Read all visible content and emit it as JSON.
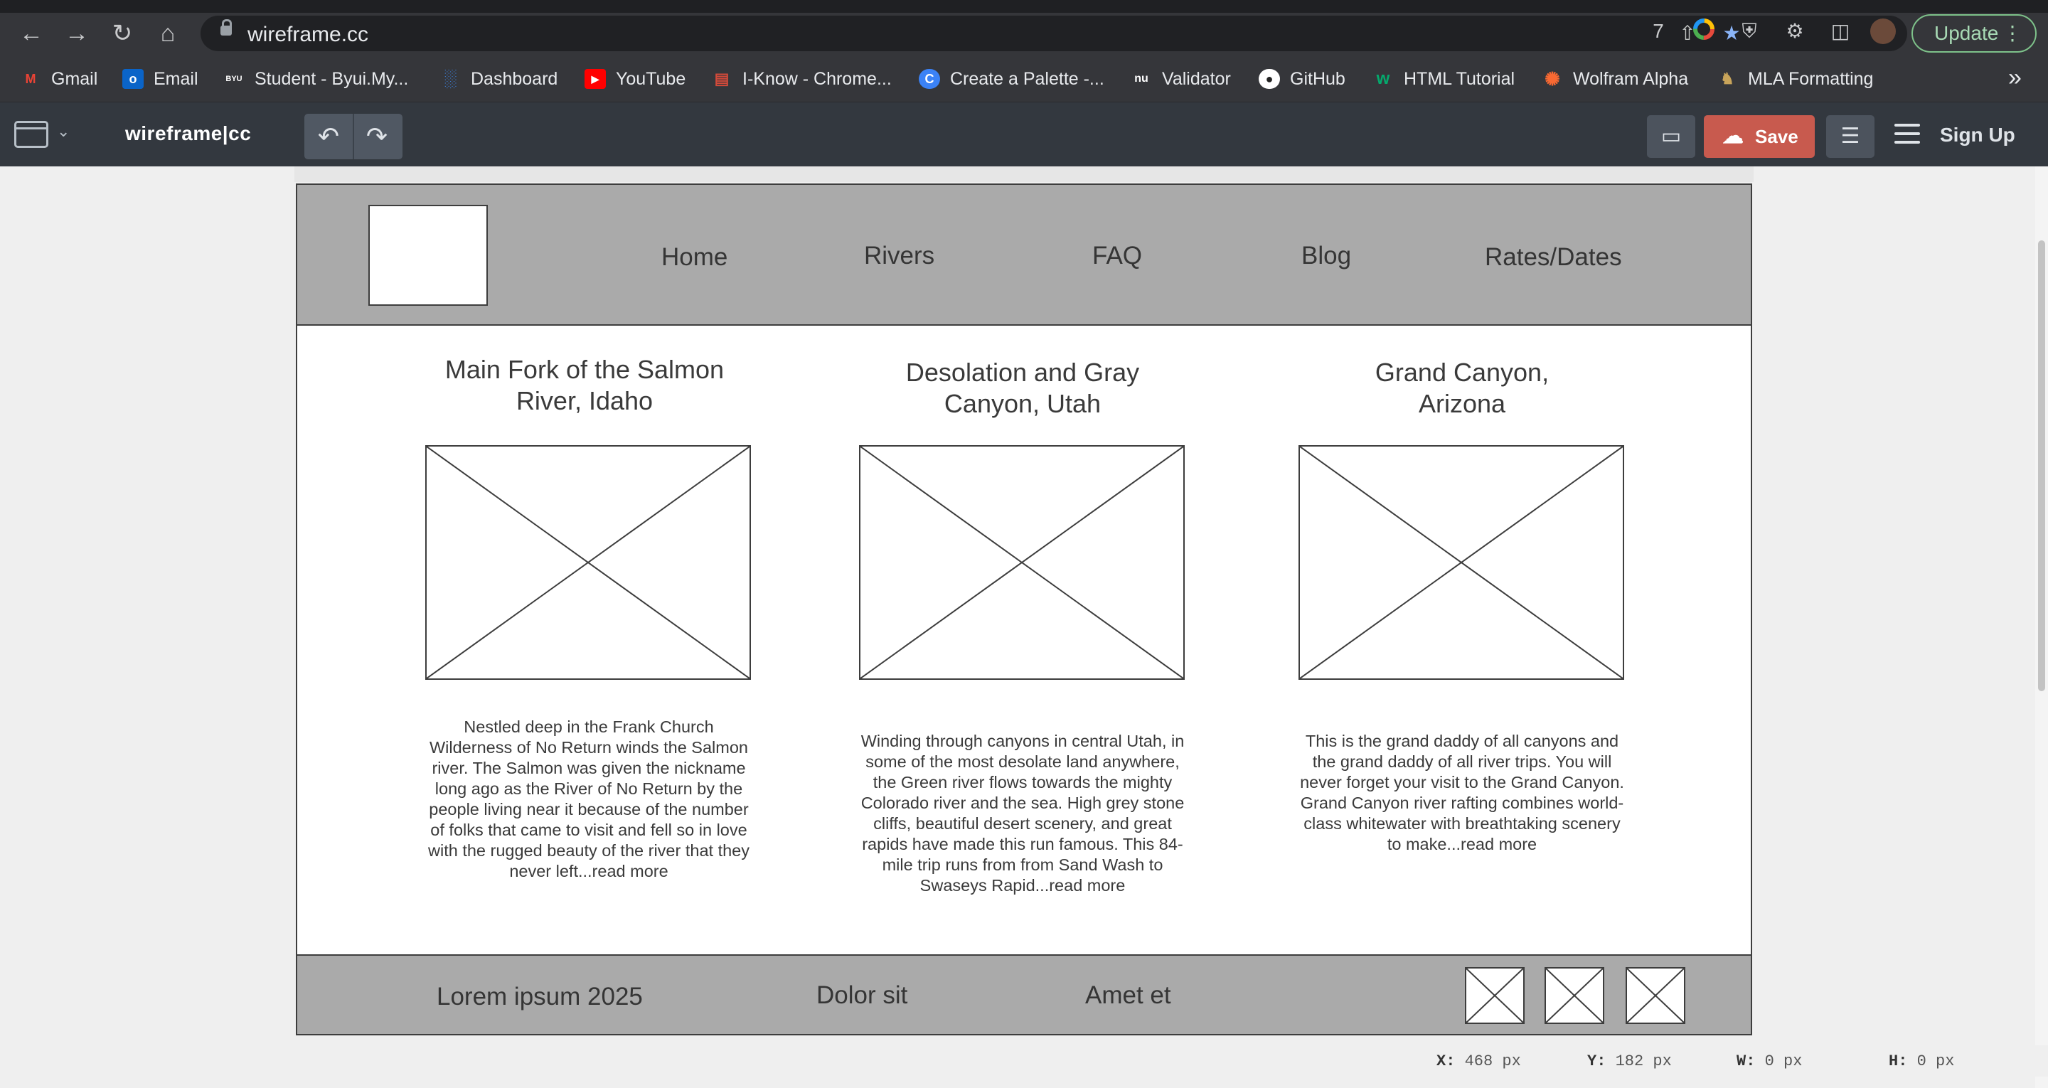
{
  "browser": {
    "url": "wireframe.cc",
    "update_label": "Update",
    "bookmarks": [
      {
        "label": "Gmail",
        "icon": "gmail-icon",
        "color": "#ea4335"
      },
      {
        "label": "Email",
        "icon": "outlook-icon",
        "color": "#0a64c8"
      },
      {
        "label": "Student - Byui.My...",
        "icon": "byui-icon",
        "color": "#555555"
      },
      {
        "label": "Dashboard",
        "icon": "dashboard-icon",
        "color": "#3d7bd0"
      },
      {
        "label": "YouTube",
        "icon": "youtube-icon",
        "color": "#ff0000"
      },
      {
        "label": "I-Know - Chrome...",
        "icon": "iknow-icon",
        "color": "#d24a3a"
      },
      {
        "label": "Create a Palette -...",
        "icon": "palette-icon",
        "color": "#3b82f6"
      },
      {
        "label": "Validator",
        "icon": "validator-icon",
        "color": "#3c3c3c"
      },
      {
        "label": "GitHub",
        "icon": "github-icon",
        "color": "#ffffff"
      },
      {
        "label": "HTML Tutorial",
        "icon": "w3schools-icon",
        "color": "#04aa6d"
      },
      {
        "label": "Wolfram Alpha",
        "icon": "wolfram-icon",
        "color": "#f96932"
      },
      {
        "label": "MLA Formatting",
        "icon": "purdue-icon",
        "color": "#c8a45a"
      }
    ]
  },
  "app": {
    "brand": "wireframe|cc",
    "save_label": "Save",
    "signup_label": "Sign Up"
  },
  "wireframe": {
    "nav": [
      "Home",
      "Rivers",
      "FAQ",
      "Blog",
      "Rates/Dates"
    ],
    "columns": [
      {
        "title_line1": "Main Fork of the Salmon",
        "title_line2": "River, Idaho",
        "text": "Nestled deep in the Frank Church Wilderness of No Return winds the Salmon river. The Salmon was given the nickname long ago as the River of No Return by the people living near it because of the number of folks that came to visit and fell so in love with the rugged beauty of the river that they never left...read more"
      },
      {
        "title_line1": "Desolation and Gray",
        "title_line2": "Canyon, Utah",
        "text": "Winding through canyons in central Utah, in some of the most desolate land anywhere, the Green river flows towards the mighty Colorado river and the sea. High grey stone cliffs, beautiful desert scenery, and great rapids have made this run famous. This 84-mile trip runs from from Sand Wash to Swaseys Rapid...read more"
      },
      {
        "title_line1": "Grand Canyon,",
        "title_line2": "Arizona",
        "text": "This is the grand daddy of all canyons and the grand daddy of all river trips. You will never forget your visit to the Grand Canyon.\nGrand Canyon river rafting combines world-class whitewater with breathtaking scenery to make...read more"
      }
    ],
    "footer": [
      "Lorem ipsum 2025",
      "Dolor sit",
      "Amet et"
    ]
  },
  "status": {
    "x_label": "X:",
    "x_value": "468 px",
    "y_label": "Y:",
    "y_value": "182 px",
    "w_label": "W:",
    "w_value": "0 px",
    "h_label": "H:",
    "h_value": "0 px"
  }
}
